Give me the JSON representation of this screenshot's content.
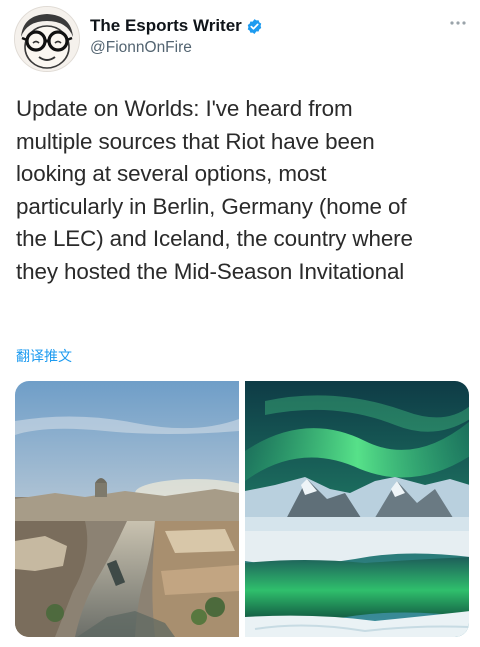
{
  "tweet": {
    "author": {
      "display_name": "The Esports Writer",
      "handle": "@FionnOnFire",
      "verified": true,
      "avatar_icon": "cartoon-face-with-glasses"
    },
    "more_icon": "ellipsis-icon",
    "lines": [
      "Update on Worlds: I've heard from",
      "multiple sources that Riot have been",
      "looking at several options, most",
      "particularly in Berlin, Germany (home of",
      "the LEC) and Iceland, the country where",
      "they hosted the Mid-Season Invitational"
    ],
    "translate_label": "翻译推文",
    "media": [
      {
        "subject": "berlin-river-cityscape"
      },
      {
        "subject": "iceland-aurora-lake"
      }
    ]
  },
  "colors": {
    "accent": "#1d9bf0",
    "text": "#0f1419",
    "secondary": "#536471"
  }
}
